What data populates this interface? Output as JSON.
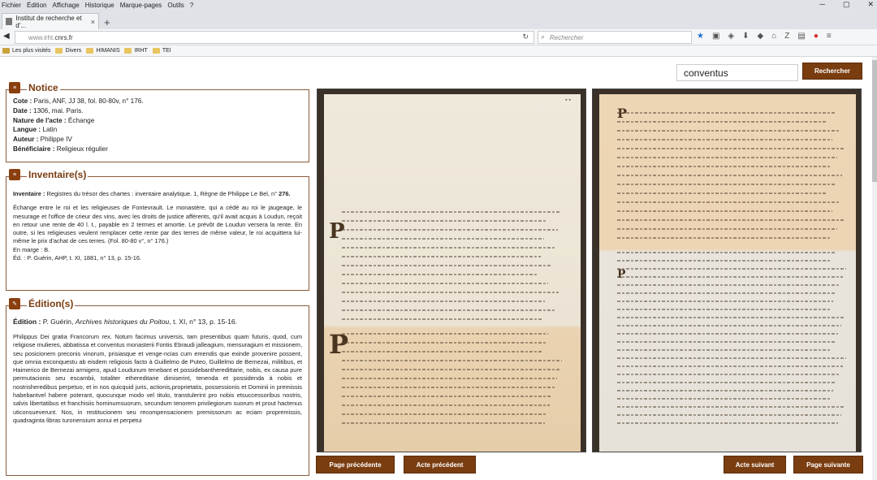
{
  "browser": {
    "menu": [
      "Fichier",
      "Édition",
      "Affichage",
      "Historique",
      "Marque-pages",
      "Outils",
      "?"
    ],
    "tab_title": "Institut de recherche et d'...",
    "url": "www.irht.cnrs.fr",
    "url_host": "www.irht.",
    "url_domain": "cnrs.fr",
    "search_placeholder": "Rechercher",
    "bookmarks": [
      "Les plus visités",
      "Divers",
      "HIMANIS",
      "IRHT",
      "TEI"
    ]
  },
  "search": {
    "value": "conventus",
    "button": "Rechercher"
  },
  "notice": {
    "title": "Notice",
    "rows": [
      {
        "label": "Cote :",
        "value": " Paris, ANF, JJ 38, fol. 80-80v, n° 176."
      },
      {
        "label": "Date :",
        "value": " 1306, mai. Paris."
      },
      {
        "label": "Nature de l'acte :",
        "value": " Échange"
      },
      {
        "label": "Langue :",
        "value": " Latin"
      },
      {
        "label": "Auteur :",
        "value": " Philippe IV"
      },
      {
        "label": "Bénéficiaire :",
        "value": " Religieux régulier"
      }
    ]
  },
  "inventaire": {
    "title": "Inventaire(s)",
    "label": "Inventaire :",
    "ref": " Registres du trésor des chartes : inventaire analytique. 1, Règne de Philippe Le Bel, n° ",
    "ref_num": "276.",
    "summary": "Échange entre le roi et les religieuses de Fontevrault. Le monastère, qui a cédé au roi le jaugeage, le mesurage et l'office de crieur des vins, avec les droits de justice afférents, qu'il avait acquis à Loudun, reçoit en retour une rente de 40 l. t., payable en 2 termes et amortie. Le prévôt de Loudun versera la rente. En outre, si les religieuses veulent remplacer cette rente par des terres de même valeur, le roi acquittera lui-même le prix d'achat de ces terres. (Fol. 80-80 v°, n° 176.)",
    "marge": "En marge : B.",
    "ed": "Éd. : P. Guérin, AHP, t. XI, 1881, n° 13, p. 15-16."
  },
  "edition": {
    "title": "Édition(s)",
    "label": "Édition :",
    "author": " P. Guérin, ",
    "work": "Archives historiques du Poitou",
    "rest": ", t. XI, n° 13, p. 15-16.",
    "text": "Philippus Dei gratia Francorum rex. Notum facimus universis, tam presentibus quam futuris, quod, cum religiose mulieres, abbatissa et conventus monasterii Fontis Ebraudi jalleagium, mensuragium et missionem, seu posicionem preconis vinorum, prisiasque et venge-ncias cum emendis que exinde provenire possent, que omnia exconquestu ab eisdem religiosis facto à Guillelmo de Puteo, Guillelmo de Bernezai, militibus, et Haimerico de Bernezai armigero, apud Loudunum tenebant et possidebantheredittarie, nobis, ex causa pure permutacionis seu escambii, totaliter ethereditarie dimiserint, tenenda et possidenda à nobis et nostrisheredibus perpetuo, et in nos quicquid juris, actionis,proprietatis, possessionis et Dominii in premissis habebantvel habere poterant, quocunque modo vel titulo, transtulerint pro nobis etsuccessoribus nostris, salvis libertatibus et franchisiis hominumsuorum, secundum tenorem privilegiorum suorum et prout hactenus uticonsueverunt. Nos, in restitucionem seu recompensacionem premissorum ac eciam propremissis, quadraginta libras turonensium annui et perpetui"
  },
  "nav": {
    "prev_page": "Page précédente",
    "prev_act": "Acte précédent",
    "next_act": "Acte suivant",
    "next_page": "Page suivante"
  }
}
